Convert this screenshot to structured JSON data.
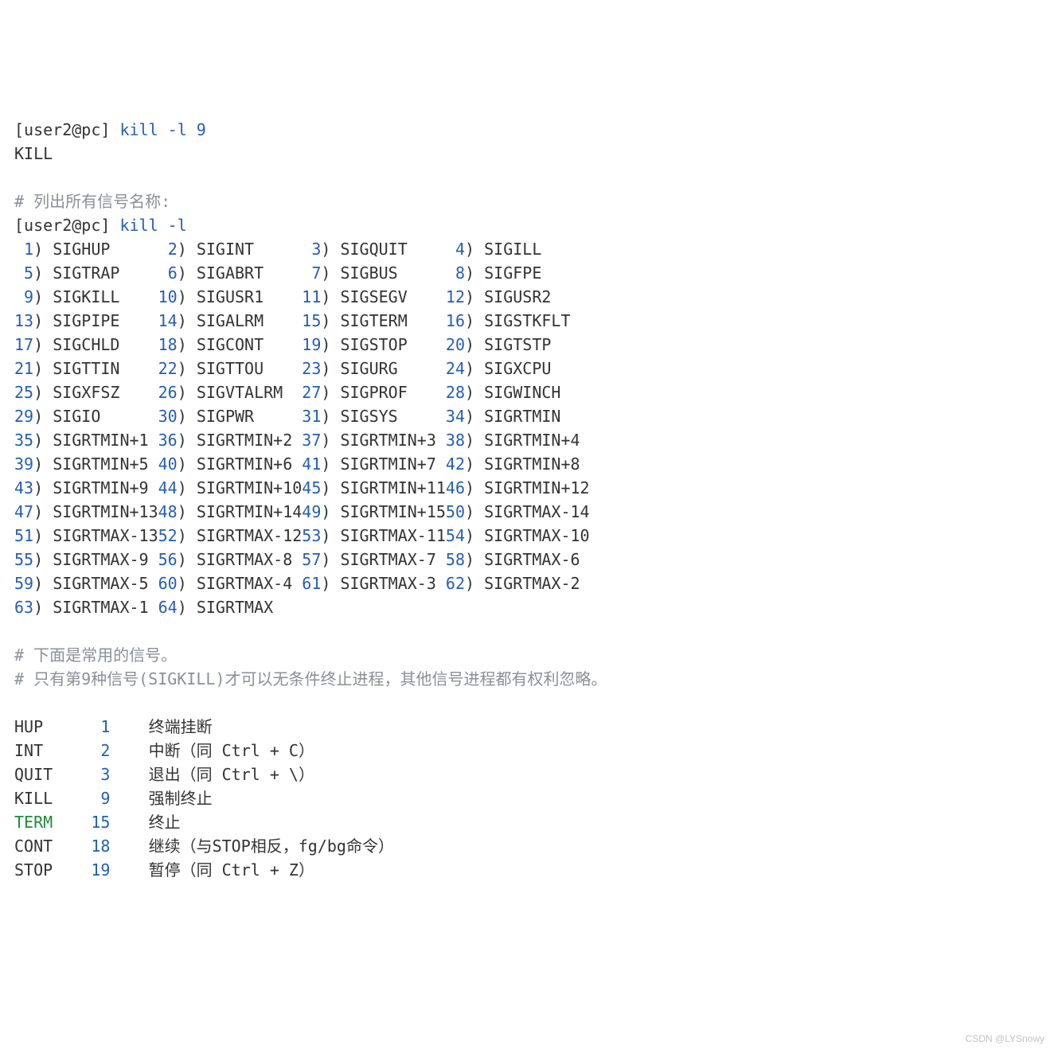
{
  "prompt1_prefix": "[user2@pc] ",
  "prompt1_cmd": "kill -l 9",
  "output1": "KILL",
  "comment_list_all": "# 列出所有信号名称:",
  "prompt2_prefix": "[user2@pc] ",
  "prompt2_cmd": "kill -l",
  "signals": [
    [
      {
        "n": "1",
        "name": "SIGHUP"
      },
      {
        "n": "2",
        "name": "SIGINT"
      },
      {
        "n": "3",
        "name": "SIGQUIT"
      },
      {
        "n": "4",
        "name": "SIGILL"
      }
    ],
    [
      {
        "n": "5",
        "name": "SIGTRAP"
      },
      {
        "n": "6",
        "name": "SIGABRT"
      },
      {
        "n": "7",
        "name": "SIGBUS"
      },
      {
        "n": "8",
        "name": "SIGFPE"
      }
    ],
    [
      {
        "n": "9",
        "name": "SIGKILL"
      },
      {
        "n": "10",
        "name": "SIGUSR1"
      },
      {
        "n": "11",
        "name": "SIGSEGV"
      },
      {
        "n": "12",
        "name": "SIGUSR2"
      }
    ],
    [
      {
        "n": "13",
        "name": "SIGPIPE"
      },
      {
        "n": "14",
        "name": "SIGALRM"
      },
      {
        "n": "15",
        "name": "SIGTERM"
      },
      {
        "n": "16",
        "name": "SIGSTKFLT"
      }
    ],
    [
      {
        "n": "17",
        "name": "SIGCHLD"
      },
      {
        "n": "18",
        "name": "SIGCONT"
      },
      {
        "n": "19",
        "name": "SIGSTOP"
      },
      {
        "n": "20",
        "name": "SIGTSTP"
      }
    ],
    [
      {
        "n": "21",
        "name": "SIGTTIN"
      },
      {
        "n": "22",
        "name": "SIGTTOU"
      },
      {
        "n": "23",
        "name": "SIGURG"
      },
      {
        "n": "24",
        "name": "SIGXCPU"
      }
    ],
    [
      {
        "n": "25",
        "name": "SIGXFSZ"
      },
      {
        "n": "26",
        "name": "SIGVTALRM"
      },
      {
        "n": "27",
        "name": "SIGPROF"
      },
      {
        "n": "28",
        "name": "SIGWINCH"
      }
    ],
    [
      {
        "n": "29",
        "name": "SIGIO"
      },
      {
        "n": "30",
        "name": "SIGPWR"
      },
      {
        "n": "31",
        "name": "SIGSYS"
      },
      {
        "n": "34",
        "name": "SIGRTMIN"
      }
    ],
    [
      {
        "n": "35",
        "name": "SIGRTMIN+1"
      },
      {
        "n": "36",
        "name": "SIGRTMIN+2"
      },
      {
        "n": "37",
        "name": "SIGRTMIN+3"
      },
      {
        "n": "38",
        "name": "SIGRTMIN+4"
      }
    ],
    [
      {
        "n": "39",
        "name": "SIGRTMIN+5"
      },
      {
        "n": "40",
        "name": "SIGRTMIN+6"
      },
      {
        "n": "41",
        "name": "SIGRTMIN+7"
      },
      {
        "n": "42",
        "name": "SIGRTMIN+8"
      }
    ],
    [
      {
        "n": "43",
        "name": "SIGRTMIN+9"
      },
      {
        "n": "44",
        "name": "SIGRTMIN+10"
      },
      {
        "n": "45",
        "name": "SIGRTMIN+11"
      },
      {
        "n": "46",
        "name": "SIGRTMIN+12"
      }
    ],
    [
      {
        "n": "47",
        "name": "SIGRTMIN+13"
      },
      {
        "n": "48",
        "name": "SIGRTMIN+14"
      },
      {
        "n": "49",
        "name": "SIGRTMIN+15"
      },
      {
        "n": "50",
        "name": "SIGRTMAX-14"
      }
    ],
    [
      {
        "n": "51",
        "name": "SIGRTMAX-13"
      },
      {
        "n": "52",
        "name": "SIGRTMAX-12"
      },
      {
        "n": "53",
        "name": "SIGRTMAX-11"
      },
      {
        "n": "54",
        "name": "SIGRTMAX-10"
      }
    ],
    [
      {
        "n": "55",
        "name": "SIGRTMAX-9"
      },
      {
        "n": "56",
        "name": "SIGRTMAX-8"
      },
      {
        "n": "57",
        "name": "SIGRTMAX-7"
      },
      {
        "n": "58",
        "name": "SIGRTMAX-6"
      }
    ],
    [
      {
        "n": "59",
        "name": "SIGRTMAX-5"
      },
      {
        "n": "60",
        "name": "SIGRTMAX-4"
      },
      {
        "n": "61",
        "name": "SIGRTMAX-3"
      },
      {
        "n": "62",
        "name": "SIGRTMAX-2"
      }
    ],
    [
      {
        "n": "63",
        "name": "SIGRTMAX-1"
      },
      {
        "n": "64",
        "name": "SIGRTMAX"
      }
    ]
  ],
  "comment_common1": "# 下面是常用的信号。",
  "comment_common2": "# 只有第9种信号(SIGKILL)才可以无条件终止进程，其他信号进程都有权利忽略。",
  "common_signals": [
    {
      "name": "HUP",
      "num": "1",
      "desc": "终端挂断",
      "style": "plain"
    },
    {
      "name": "INT",
      "num": "2",
      "desc": "中断（同 Ctrl + C）",
      "style": "plain"
    },
    {
      "name": "QUIT",
      "num": "3",
      "desc": "退出（同 Ctrl + \\）",
      "style": "plain"
    },
    {
      "name": "KILL",
      "num": "9",
      "desc": "强制终止",
      "style": "plain"
    },
    {
      "name": "TERM",
      "num": "15",
      "desc": "终止",
      "style": "term"
    },
    {
      "name": "CONT",
      "num": "18",
      "desc": "继续（与STOP相反，fg/bg命令）",
      "style": "plain"
    },
    {
      "name": "STOP",
      "num": "19",
      "desc": "暂停（同 Ctrl + Z）",
      "style": "plain"
    }
  ],
  "watermark": "CSDN @LYSnowy"
}
